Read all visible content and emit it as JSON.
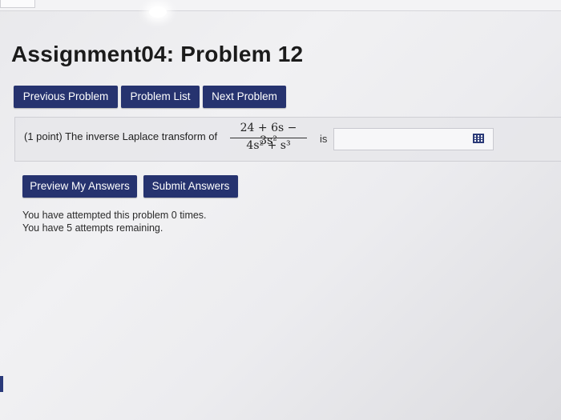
{
  "page": {
    "title": "Assignment04: Problem 12"
  },
  "nav": {
    "previous": "Previous Problem",
    "list": "Problem List",
    "next": "Next Problem"
  },
  "problem": {
    "text": "(1 point) The inverse Laplace transform of",
    "numerator": "24 + 6s − 3s²",
    "denominator": "4s² + s³",
    "suffix": "is",
    "answer_value": "",
    "icon": "grid-icon"
  },
  "actions": {
    "preview": "Preview My Answers",
    "submit": "Submit Answers"
  },
  "status": {
    "attempted": "You have attempted this problem 0 times.",
    "remaining": "You have 5 attempts remaining."
  },
  "colors": {
    "button_bg": "#26336f",
    "button_text": "#ffffff"
  }
}
